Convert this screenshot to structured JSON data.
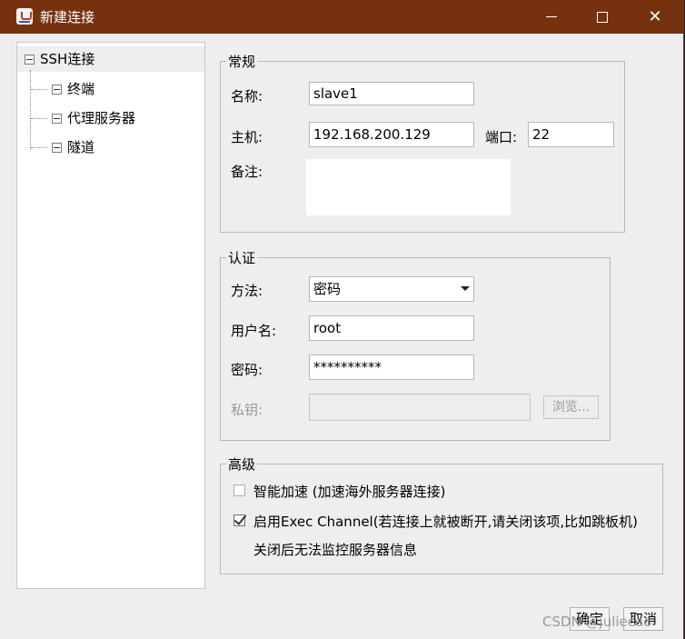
{
  "window": {
    "title": "新建连接",
    "icon": "java-cup-icon"
  },
  "tree": {
    "root": "SSH连接",
    "children": [
      "终端",
      "代理服务器",
      "隧道"
    ]
  },
  "general": {
    "legend": "常规",
    "name_label": "名称:",
    "name_value": "slave1",
    "host_label": "主机:",
    "host_value": "192.168.200.129",
    "port_label": "端口:",
    "port_value": "22",
    "note_label": "备注:",
    "note_value": ""
  },
  "auth": {
    "legend": "认证",
    "method_label": "方法:",
    "method_value": "密码",
    "user_label": "用户名:",
    "user_value": "root",
    "pass_label": "密码:",
    "pass_value": "**********",
    "key_label": "私钥:",
    "key_value": "",
    "browse_label": "浏览..."
  },
  "advanced": {
    "legend": "高级",
    "smart_accel_label": "智能加速 (加速海外服务器连接)",
    "smart_accel_checked": false,
    "exec_channel_label": "启用Exec Channel(若连接上就被断开,请关闭该项,比如跳板机)",
    "exec_channel_checked": true,
    "exec_channel_note": "关闭后无法监控服务器信息"
  },
  "buttons": {
    "ok": "确定",
    "cancel": "取消"
  },
  "watermark": "CSDN @juliecao"
}
